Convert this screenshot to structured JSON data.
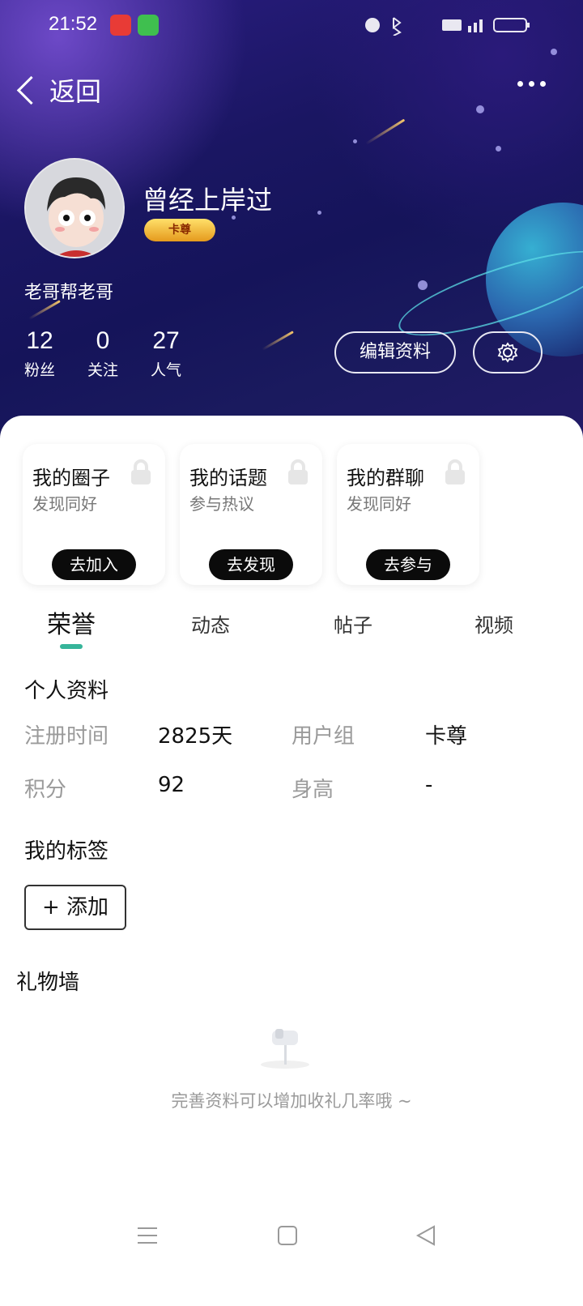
{
  "status_bar": {
    "time": "21:52",
    "right_icons": [
      "alarm-icon",
      "bluetooth-icon",
      "speed-text",
      "hd-icon",
      "signal-icon",
      "battery-icon"
    ]
  },
  "header": {
    "back_label": "返回"
  },
  "profile": {
    "username": "曾经上岸过",
    "badge": "卡尊",
    "signature": "老哥帮老哥",
    "stats": [
      {
        "value": "12",
        "label": "粉丝"
      },
      {
        "value": "0",
        "label": "关注"
      },
      {
        "value": "27",
        "label": "人气"
      }
    ],
    "edit_label": "编辑资料"
  },
  "cards": [
    {
      "title": "我的圈子",
      "subtitle": "发现同好",
      "button": "去加入"
    },
    {
      "title": "我的话题",
      "subtitle": "参与热议",
      "button": "去发现"
    },
    {
      "title": "我的群聊",
      "subtitle": "发现同好",
      "button": "去参与"
    }
  ],
  "tabs": [
    {
      "label": "荣誉",
      "active": true
    },
    {
      "label": "动态",
      "active": false
    },
    {
      "label": "帖子",
      "active": false
    },
    {
      "label": "视频",
      "active": false
    }
  ],
  "personal_info": {
    "title": "个人资料",
    "rows": [
      {
        "k1": "注册时间",
        "v1": "2825天",
        "k2": "用户组",
        "v2": "卡尊"
      },
      {
        "k1": "积分",
        "v1": "92",
        "k2": "身高",
        "v2": "-"
      }
    ]
  },
  "tags": {
    "title": "我的标签",
    "add_label": "+ 添加"
  },
  "gifts": {
    "title": "礼物墙",
    "empty_text": "完善资料可以增加收礼几率哦 ~"
  },
  "colors": {
    "accent": "#36b59a",
    "hero_bg": "#1a1662"
  }
}
